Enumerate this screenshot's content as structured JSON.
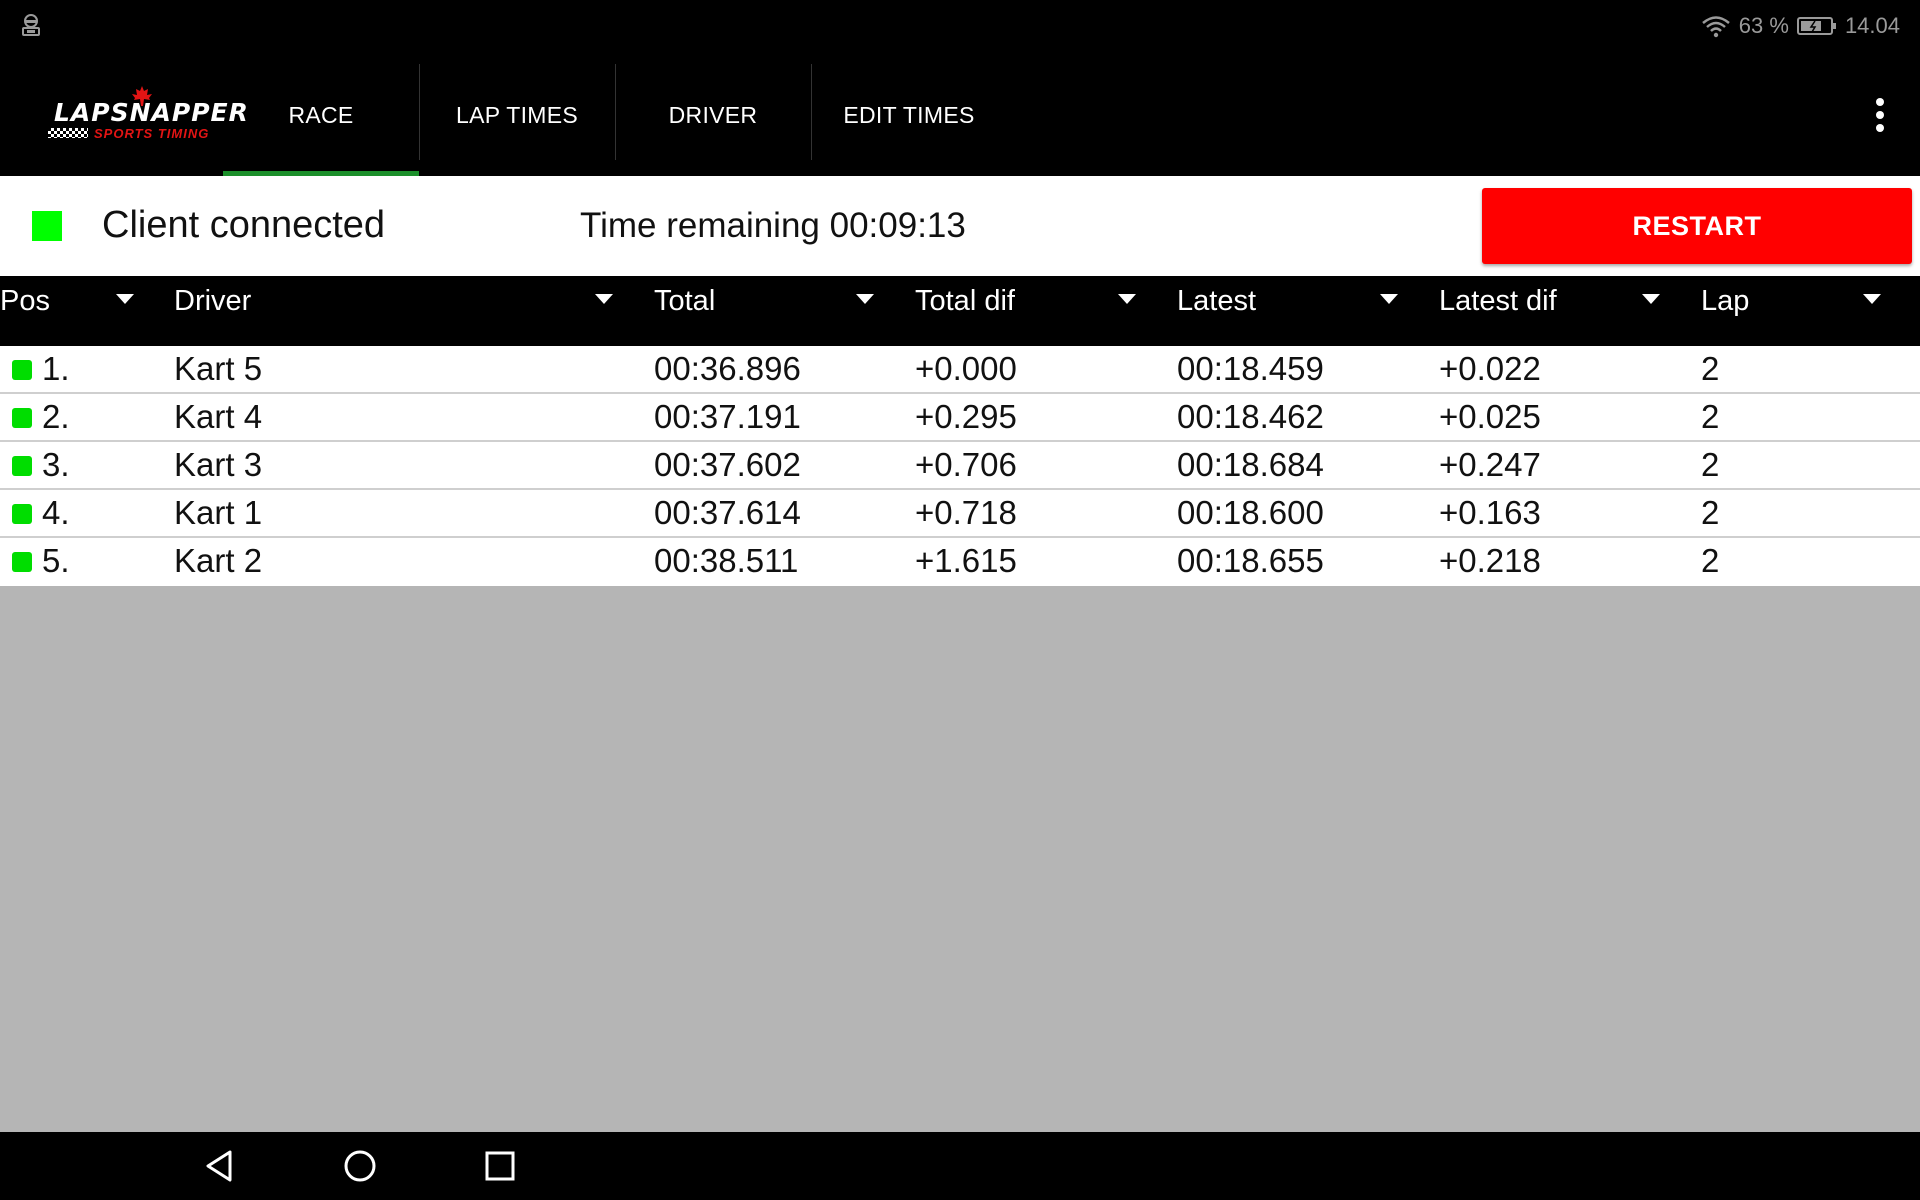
{
  "status_bar": {
    "battery_percent": "63 %",
    "clock": "14.04",
    "icons": [
      "notification-icon",
      "wifi-icon",
      "battery-icon"
    ]
  },
  "app": {
    "logo": {
      "name": "LAPSNAPPER",
      "tagline": "SPORTS TIMING"
    },
    "tabs": [
      {
        "label": "RACE",
        "active": true
      },
      {
        "label": "LAP TIMES",
        "active": false
      },
      {
        "label": "DRIVER",
        "active": false
      },
      {
        "label": "EDIT TIMES",
        "active": false
      }
    ],
    "menu_icon": "more-vert-icon"
  },
  "info_bar": {
    "connection_text": "Client connected",
    "connection_color": "#00ff00",
    "time_remaining": "Time remaining 00:09:13",
    "restart_label": "RESTART",
    "restart_color": "#ff0000"
  },
  "table": {
    "columns": [
      "Pos",
      "Driver",
      "Total",
      "Total dif",
      "Latest",
      "Latest dif",
      "Lap"
    ],
    "rows": [
      {
        "pos": "1.",
        "driver": "Kart 5",
        "total": "00:36.896",
        "total_dif": "+0.000",
        "latest": "00:18.459",
        "latest_dif": "+0.022",
        "lap": "2"
      },
      {
        "pos": "2.",
        "driver": "Kart 4",
        "total": "00:37.191",
        "total_dif": "+0.295",
        "latest": "00:18.462",
        "latest_dif": "+0.025",
        "lap": "2"
      },
      {
        "pos": "3.",
        "driver": "Kart 3",
        "total": "00:37.602",
        "total_dif": "+0.706",
        "latest": "00:18.684",
        "latest_dif": "+0.247",
        "lap": "2"
      },
      {
        "pos": "4.",
        "driver": "Kart 1",
        "total": "00:37.614",
        "total_dif": "+0.718",
        "latest": "00:18.600",
        "latest_dif": "+0.163",
        "lap": "2"
      },
      {
        "pos": "5.",
        "driver": "Kart 2",
        "total": "00:38.511",
        "total_dif": "+1.615",
        "latest": "00:18.655",
        "latest_dif": "+0.218",
        "lap": "2"
      }
    ],
    "row_status_color": "#00dd00"
  },
  "nav_bar": {
    "icons": [
      "back-icon",
      "home-icon",
      "recents-icon"
    ]
  }
}
